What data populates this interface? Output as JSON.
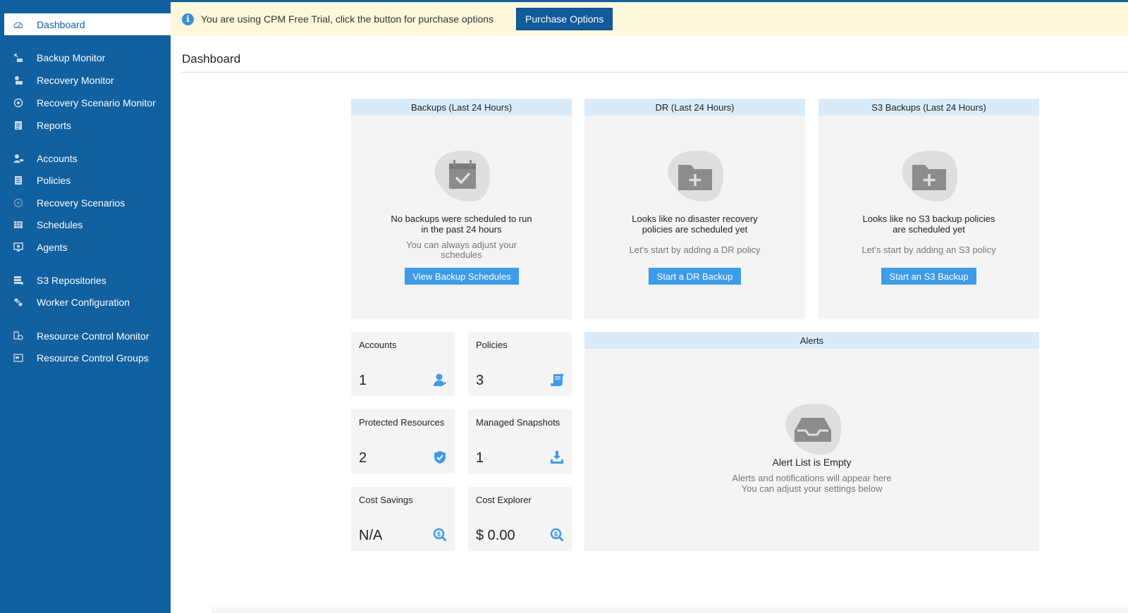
{
  "sidebar": {
    "items": [
      {
        "label": "Dashboard",
        "icon": "dashboard-icon",
        "active": true
      },
      {
        "label": "Backup Monitor",
        "icon": "backup-monitor-icon"
      },
      {
        "label": "Recovery Monitor",
        "icon": "recovery-monitor-icon"
      },
      {
        "label": "Recovery Scenario Monitor",
        "icon": "recovery-scenario-monitor-icon"
      },
      {
        "label": "Reports",
        "icon": "reports-icon"
      },
      {
        "label": "Accounts",
        "icon": "accounts-icon"
      },
      {
        "label": "Policies",
        "icon": "policies-icon"
      },
      {
        "label": "Recovery Scenarios",
        "icon": "recovery-scenarios-icon"
      },
      {
        "label": "Schedules",
        "icon": "schedules-icon"
      },
      {
        "label": "Agents",
        "icon": "agents-icon"
      },
      {
        "label": "S3 Repositories",
        "icon": "s3-repositories-icon"
      },
      {
        "label": "Worker Configuration",
        "icon": "worker-configuration-icon"
      },
      {
        "label": "Resource Control Monitor",
        "icon": "resource-control-monitor-icon"
      },
      {
        "label": "Resource Control Groups",
        "icon": "resource-control-groups-icon"
      }
    ]
  },
  "banner": {
    "message": "You are using CPM Free Trial, click the button for purchase options",
    "button": "Purchase Options"
  },
  "page": {
    "title": "Dashboard"
  },
  "cards": {
    "backups": {
      "header": "Backups (Last 24 Hours)",
      "title_line1": "No backups were scheduled to run",
      "title_line2": "in the past 24 hours",
      "sub_line1": "You can always adjust your",
      "sub_line2": "schedules",
      "button": "View Backup Schedules"
    },
    "dr": {
      "header": "DR (Last 24 Hours)",
      "title_line1": "Looks like no disaster recovery",
      "title_line2": "policies are scheduled yet",
      "sub_line1": "Let's start by adding a DR policy",
      "button": "Start a DR Backup"
    },
    "s3": {
      "header": "S3 Backups (Last 24 Hours)",
      "title_line1": "Looks like no S3 backup policies",
      "title_line2": "are scheduled yet",
      "sub_line1": "Let's start by adding an S3 policy",
      "button": "Start an S3 Backup"
    },
    "alerts": {
      "header": "Alerts",
      "title": "Alert List is Empty",
      "sub_line1": "Alerts and notifications will appear here",
      "sub_line2": "You can adjust your settings below"
    }
  },
  "stats": {
    "accounts": {
      "label": "Accounts",
      "value": "1",
      "icon": "user-icon"
    },
    "policies": {
      "label": "Policies",
      "value": "3",
      "icon": "scroll-icon"
    },
    "protected": {
      "label": "Protected Resources",
      "value": "2",
      "icon": "shield-check-icon"
    },
    "snapshots": {
      "label": "Managed Snapshots",
      "value": "1",
      "icon": "download-icon"
    },
    "cost_savings": {
      "label": "Cost Savings",
      "value": "N/A",
      "icon": "dollar-search-icon"
    },
    "cost_explorer": {
      "label": "Cost Explorer",
      "value": "$ 0.00",
      "icon": "dollar-search-icon"
    }
  },
  "colors": {
    "sidebar": "#1160a0",
    "banner": "#fdf8dc",
    "card_header": "#d9ebf9",
    "action_button": "#3e9be9",
    "stat_icon": "#3e9be9"
  }
}
